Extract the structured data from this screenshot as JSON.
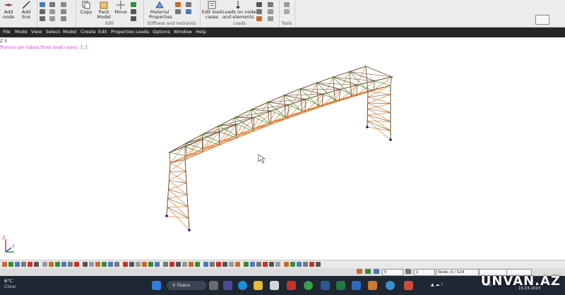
{
  "ribbon": {
    "buttons": {
      "add_node": "Add\nnode",
      "add_line": "Add\nline",
      "copy": "Copy",
      "pack_model": "Pack\nModel",
      "move": "Move",
      "material_properties": "Material\nProperties",
      "edit_load_cases": "Edit load\ncases",
      "loads_on_nodes": "Loads on nodes\nand elements"
    },
    "groups": {
      "edit": "Edit",
      "stiffness": "Stiffness and restraints",
      "loads": "Loads",
      "tools": "Tools"
    }
  },
  "menubar": [
    "File",
    "Mode",
    "View",
    "Select",
    "Model",
    "Create",
    "Edit",
    "Properties",
    "Loads",
    "Options",
    "Window",
    "Help"
  ],
  "canvas": {
    "corner_label": "Z X",
    "hint": "Forces are taken from load cases:  1,2",
    "axis_z": "Z",
    "axis_y": "Y"
  },
  "status": {
    "field_a": "5",
    "field_b": "1",
    "node_counter": "Node: 0 / 524"
  },
  "taskbar": {
    "temperature": "6°C",
    "condition": "Clear",
    "search_placeholder": "Поиск",
    "lang": "AZE",
    "date": "15.03.2023"
  },
  "watermark": "UNVAN.AZ",
  "colors": {
    "member_orange": "#e07a2c",
    "member_green": "#3a8a3a",
    "member_dark": "#6b4a2a",
    "support_node": "#1a1a6a",
    "hint": "#d13bd1"
  }
}
